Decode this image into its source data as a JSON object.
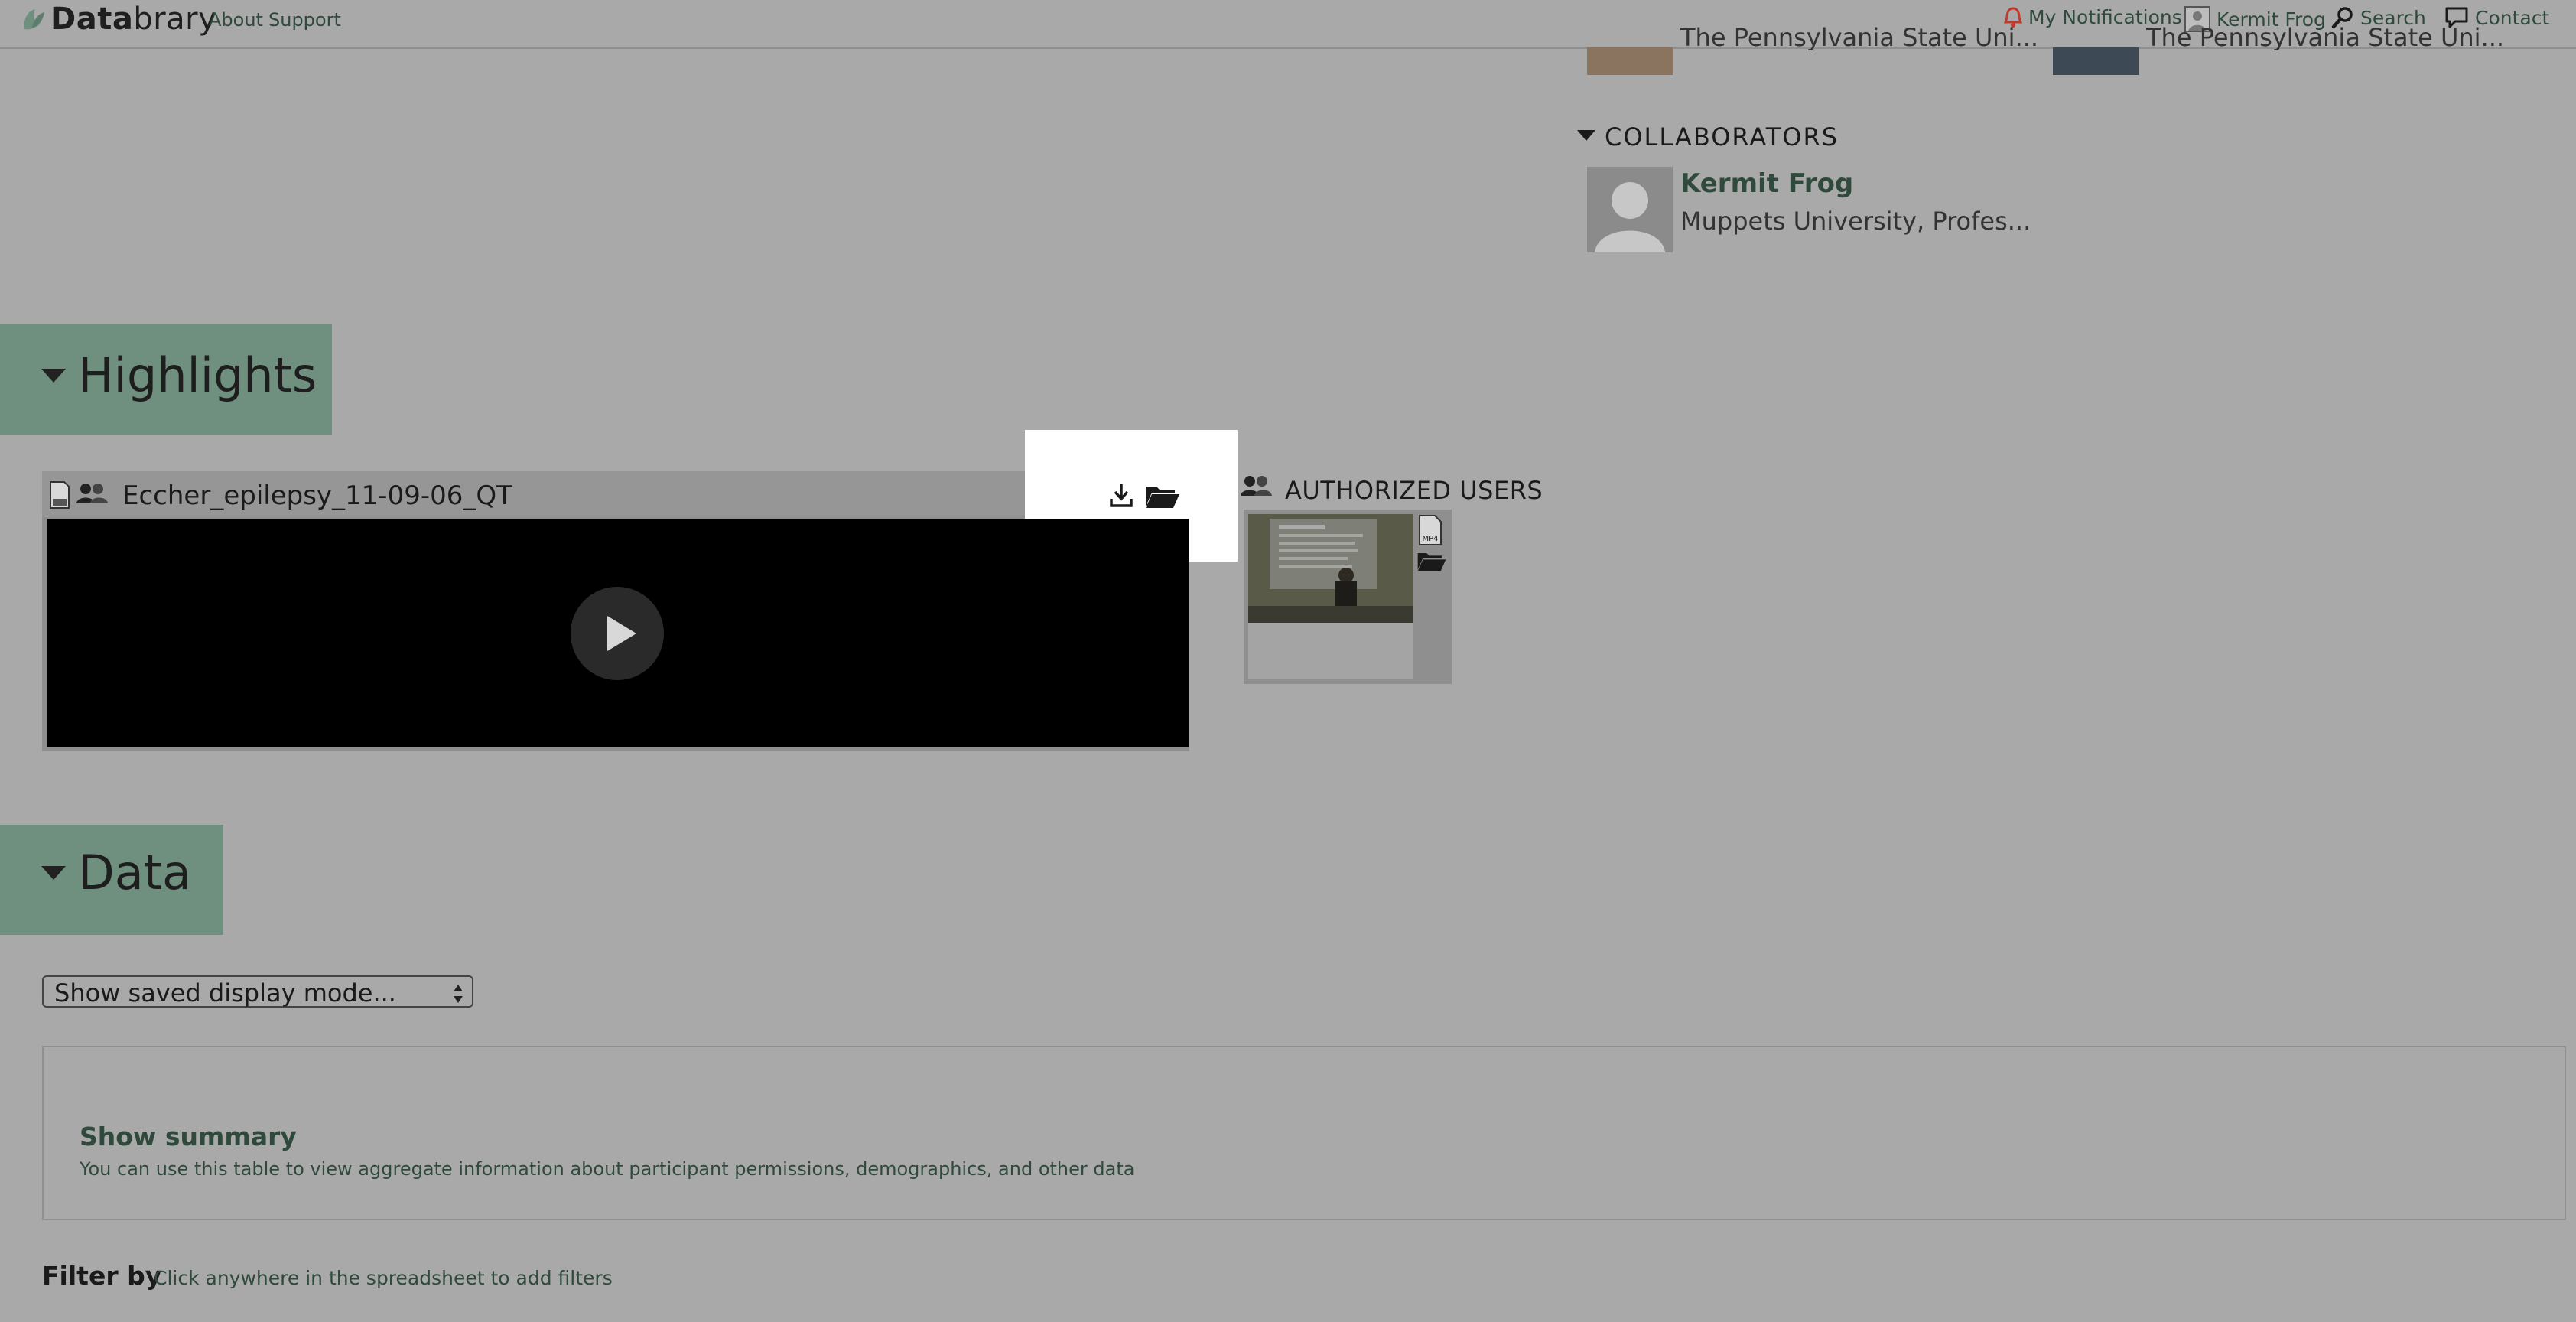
{
  "nav": {
    "brand_prefix": "Data",
    "brand_suffix": "brary",
    "links": [
      {
        "label": "About"
      },
      {
        "label": "Support"
      }
    ],
    "notifications": "My Notifications",
    "user": "Kermit Frog",
    "search": "Search",
    "contact": "Contact"
  },
  "top_people": [
    {
      "affiliation": "The Pennsylvania State Uni..."
    },
    {
      "affiliation": "The Pennsylvania State Uni..."
    }
  ],
  "collaborators": {
    "heading": "COLLABORATORS",
    "items": [
      {
        "name": "Kermit Frog",
        "affiliation": "Muppets University, Profes..."
      }
    ]
  },
  "highlights": {
    "heading": "Highlights",
    "video": {
      "title": "Eccher_epilepsy_11-09-06_QT"
    },
    "authorized_users_label": "AUTHORIZED USERS",
    "thumb_format": "MP4"
  },
  "data_section": {
    "heading": "Data",
    "display_mode_select": "Show saved display mode...",
    "summary_link": "Show summary",
    "summary_desc": "You can use this table to view aggregate information about participant permissions, demographics, and other data",
    "filter_label": "Filter by",
    "filter_hint": "Click anywhere in the spreadsheet to add filters"
  },
  "colors": {
    "page_bg": "#a9a9a9",
    "accent_green": "#2f4a3c",
    "section_header_bg": "#6f8f7f",
    "notification_bell": "#c0392b"
  }
}
